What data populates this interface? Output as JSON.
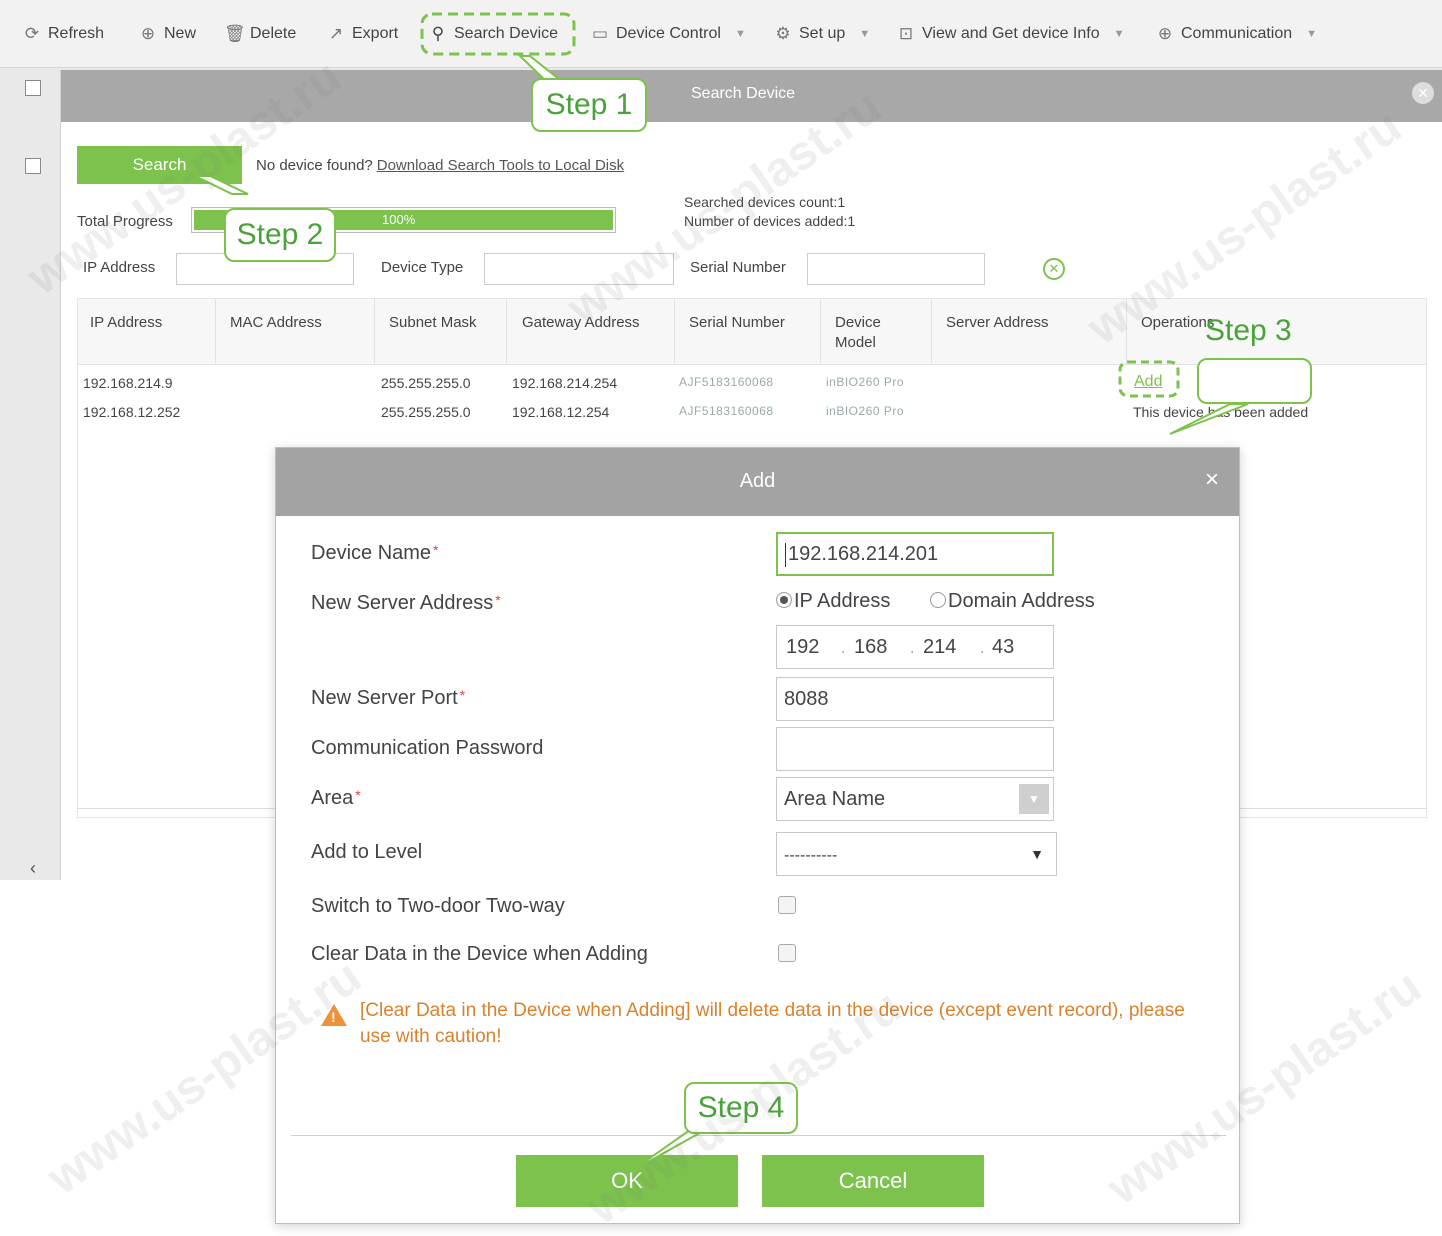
{
  "toolbar": {
    "refresh": "Refresh",
    "new": "New",
    "delete": "Delete",
    "export": "Export",
    "search_device": "Search Device",
    "device_control": "Device Control",
    "set_up": "Set up",
    "view_info": "View and Get device Info",
    "communication": "Communication"
  },
  "search_window": {
    "title": "Search Device",
    "search_button": "Search",
    "no_device_text": "No device found?",
    "download_link": "Download Search Tools to Local Disk",
    "progress_label": "Total Progress",
    "progress_text": "100%",
    "progress_value": 1.0,
    "searched_count": "Searched devices count:1",
    "added_count": "Number of devices added:1",
    "filters": {
      "ip_label": "IP Address",
      "type_label": "Device Type",
      "serial_label": "Serial Number"
    },
    "columns": [
      "IP Address",
      "MAC Address",
      "Subnet Mask",
      "Gateway Address",
      "Serial Number",
      "Device Model",
      "Server Address",
      "Operations"
    ],
    "rows": [
      {
        "ip": "192.168.214.9",
        "mac": "",
        "subnet": "255.255.255.0",
        "gateway": "192.168.214.254",
        "serial": "AJF5183160068",
        "model": "inBIO260 Pro",
        "server": "",
        "operation": "Add"
      },
      {
        "ip": "192.168.12.252",
        "mac": "",
        "subnet": "255.255.255.0",
        "gateway": "192.168.12.254",
        "serial": "AJF5183160068",
        "model": "inBIO260 Pro",
        "server": "",
        "operation": "This device has been added"
      }
    ]
  },
  "add_dialog": {
    "title": "Add",
    "close": "×",
    "device_name_label": "Device Name",
    "device_name_value": "192.168.214.201",
    "server_address_label": "New Server Address",
    "radio_ip": "IP Address",
    "radio_domain": "Domain Address",
    "ip_parts": [
      "192",
      "168",
      "214",
      "43"
    ],
    "server_port_label": "New Server Port",
    "server_port_value": "8088",
    "comm_password_label": "Communication Password",
    "comm_password_value": "",
    "area_label": "Area",
    "area_value": "Area Name",
    "level_label": "Add to Level",
    "level_value": "----------",
    "two_door_label": "Switch to Two-door Two-way",
    "clear_data_label": "Clear Data in the Device when Adding",
    "warning": "[Clear Data in the Device when Adding] will delete data in the device (except event record), please use with caution!",
    "ok": "OK",
    "cancel": "Cancel"
  },
  "steps": {
    "step1": "Step 1",
    "step2": "Step 2",
    "step3": "Step 3",
    "step4": "Step 4"
  },
  "watermark": "www.us-plast.ru",
  "colors": {
    "accent_green": "#7cc24c",
    "warning_orange": "#d9822b",
    "required_red": "#e0413b"
  }
}
